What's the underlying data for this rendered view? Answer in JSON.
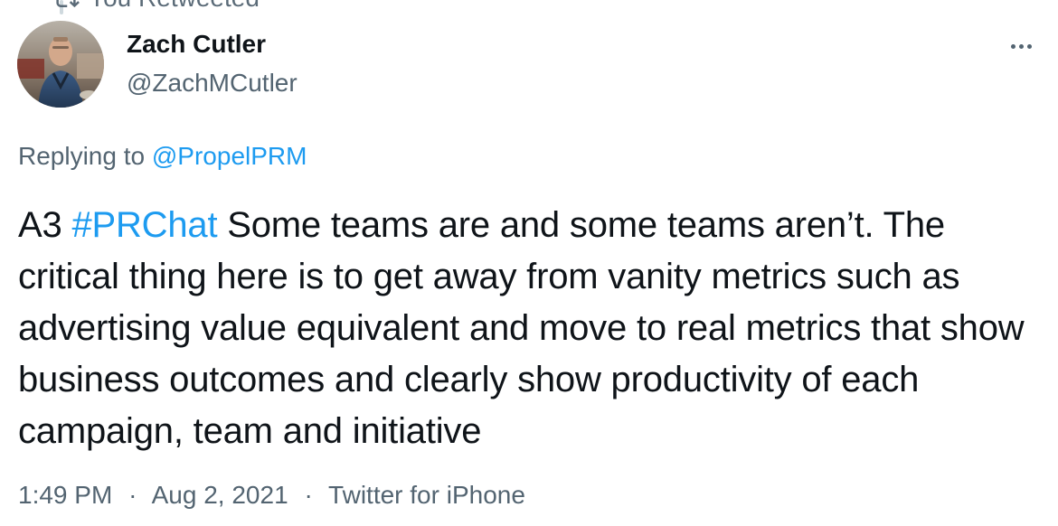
{
  "tweet": {
    "display_name": "Zach Cutler",
    "username": "@ZachMCutler",
    "replying_to_prefix": "Replying to",
    "replying_to_handle": "@PropelPRM",
    "text_prefix": "A3 ",
    "hashtag": "#PRChat",
    "text_body": " Some teams are and some teams aren’t. The critical thing here is to get away from vanity metrics such as advertising value equivalent and move to real metrics that show business outcomes and clearly show productivity of each campaign, team and initiative",
    "time": "1:49 PM",
    "date": "Aug 2, 2021",
    "source": "Twitter for iPhone",
    "separator": "·"
  },
  "top_context": {
    "text": "You Retweeted"
  },
  "icons": {
    "more": "more-horizontal-icon",
    "retweet": "retweet-icon",
    "avatar": "avatar"
  },
  "colors": {
    "link": "#1d9bf0",
    "secondary_text": "#536471",
    "primary_text": "#0f1419",
    "background": "#ffffff"
  }
}
